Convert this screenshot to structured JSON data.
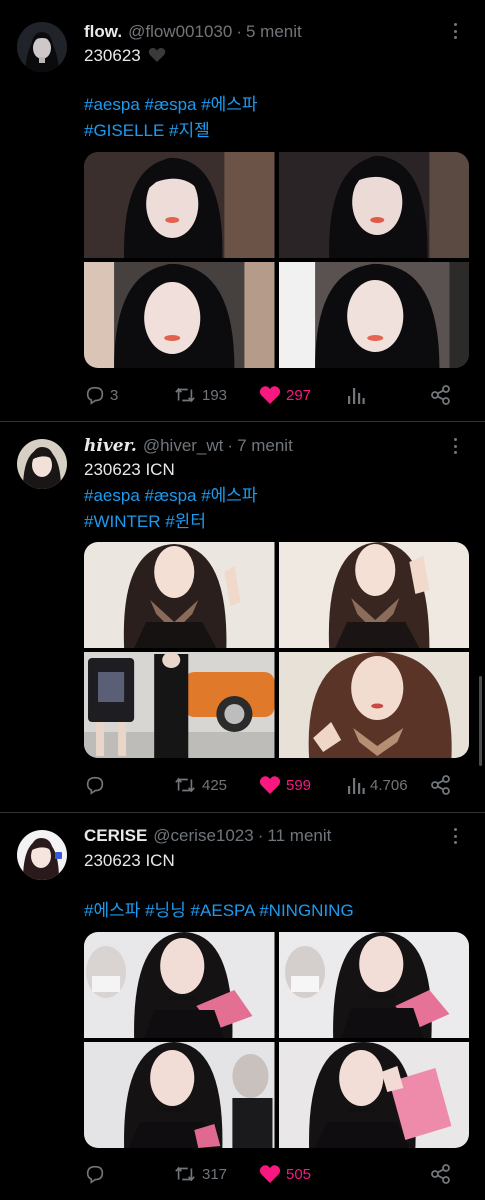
{
  "colors": {
    "background": "#000000",
    "text": "#e7e9ea",
    "muted": "#71767b",
    "link": "#1d9bf0",
    "like": "#f91880"
  },
  "tweets": [
    {
      "name": "flow.",
      "handle": "@flow001030",
      "time": "5 menit",
      "line1": "230623",
      "line1_icon": "black-heart-icon",
      "tags_a": "#aespa #æspa #에스파",
      "tags_b": "#GISELLE #지젤",
      "reply_count": "3",
      "retweet_count": "193",
      "like_count": "297",
      "views_count": "",
      "photo_subjects": [
        "dark-haired woman portrait",
        "dark-haired woman portrait",
        "dark-haired woman portrait",
        "dark-haired woman portrait"
      ]
    },
    {
      "name": "hiver.",
      "handle": "@hiver_wt",
      "time": "7 menit",
      "line1": "230623 ICN",
      "tags_a": "#aespa  #æspa #에스파",
      "tags_b": "#WINTER #윈터",
      "reply_count": "",
      "retweet_count": "425",
      "like_count": "599",
      "views_count": "4.706",
      "photo_subjects": [
        "woman with scarf",
        "woman with scarf",
        "full-body street photo",
        "woman with scarf close-up"
      ]
    },
    {
      "name": "CERISE",
      "handle": "@cerise1023",
      "time": "11 menit",
      "line1": "230623 ICN",
      "tags_a": "#에스파 #닝닝 #AESPA #NINGNING",
      "reply_count": "",
      "retweet_count": "317",
      "like_count": "505",
      "views_count": "",
      "photo_subjects": [
        "woman in black with pink item",
        "woman in black with pink item",
        "woman in black with pink item",
        "woman in black with pink item"
      ]
    }
  ],
  "icons": {
    "reply": "reply-icon",
    "retweet": "retweet-icon",
    "like": "heart-filled-icon",
    "views": "views-icon",
    "share": "share-icon",
    "more": "more-icon"
  }
}
